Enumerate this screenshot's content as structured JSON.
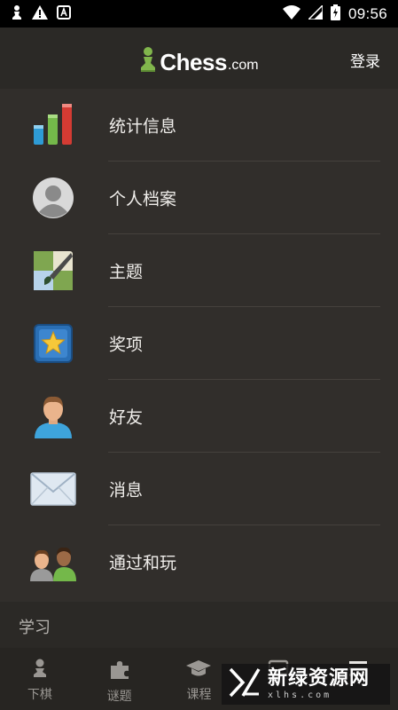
{
  "status_bar": {
    "time": "09:56",
    "left_icons": [
      "chess-pawn-icon",
      "warning-icon",
      "a-box-icon"
    ],
    "right_icons": [
      "wifi-icon",
      "signal-icon",
      "battery-charging-icon"
    ]
  },
  "header": {
    "logo_text": "Chess",
    "logo_suffix": ".com",
    "login_label": "登录"
  },
  "menu": {
    "items": [
      {
        "label": "统计信息",
        "icon": "stats-bars-icon"
      },
      {
        "label": "个人档案",
        "icon": "profile-avatar-icon"
      },
      {
        "label": "主题",
        "icon": "theme-brush-icon"
      },
      {
        "label": "奖项",
        "icon": "award-star-icon"
      },
      {
        "label": "好友",
        "icon": "friend-icon"
      },
      {
        "label": "消息",
        "icon": "message-envelope-icon"
      },
      {
        "label": "通过和玩",
        "icon": "pass-and-play-icon"
      }
    ]
  },
  "section": {
    "title": "学习"
  },
  "bottom_nav": {
    "items": [
      {
        "label": "下棋",
        "icon": "pawn-icon"
      },
      {
        "label": "谜题",
        "icon": "puzzle-icon"
      },
      {
        "label": "课程",
        "icon": "graduation-cap-icon"
      },
      {
        "label": "",
        "icon": "tv-icon"
      },
      {
        "label": "",
        "icon": "menu-icon"
      }
    ]
  },
  "watermark": {
    "text_cn": "新绿资源网",
    "text_en": "xlhs.com"
  },
  "colors": {
    "background": "#312e2b",
    "header": "#2b2926",
    "logo_green": "#81b64c"
  }
}
